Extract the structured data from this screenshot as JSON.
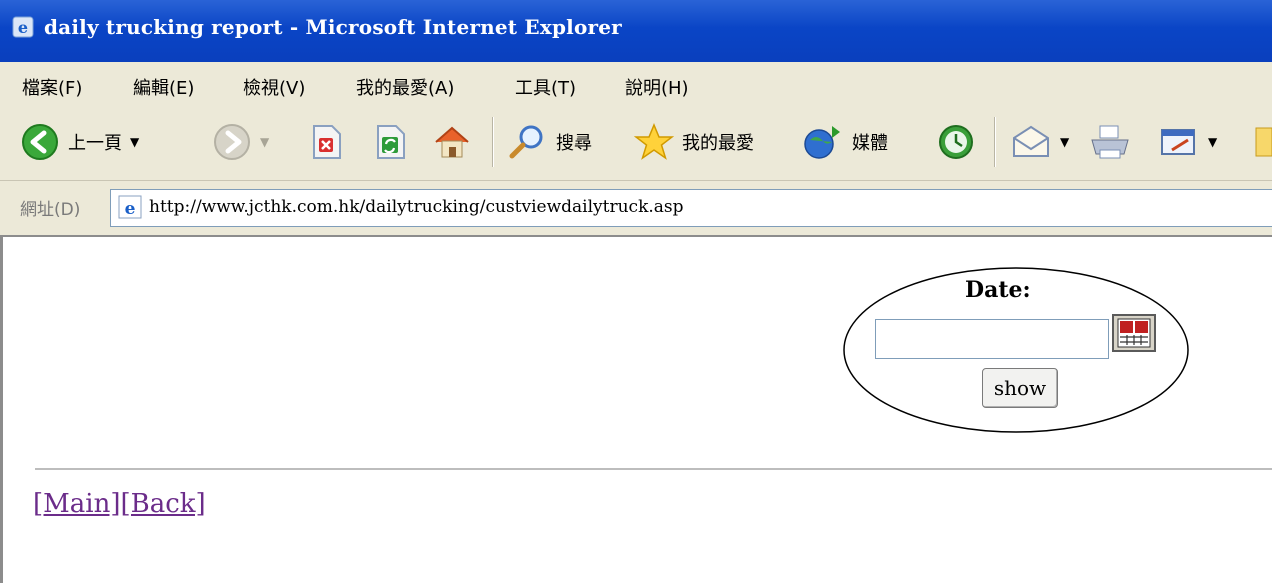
{
  "window": {
    "title": "daily trucking report - Microsoft Internet Explorer"
  },
  "menu": {
    "items": [
      "檔案(F)",
      "編輯(E)",
      "檢視(V)",
      "我的最愛(A)",
      "工具(T)",
      "說明(H)"
    ]
  },
  "toolbar": {
    "back_label": "上一頁",
    "search_label": "搜尋",
    "favorites_label": "我的最愛",
    "media_label": "媒體"
  },
  "address": {
    "label": "網址(D)",
    "url": "http://www.jcthk.com.hk/dailytrucking/custviewdailytruck.asp"
  },
  "form": {
    "date_label": "Date:",
    "date_value": "",
    "show_label": "show"
  },
  "links": {
    "main": "[Main]",
    "back": "[Back]"
  },
  "colors": {
    "titlebar": "#0a45c6",
    "chrome": "#ece9d8",
    "visited_link": "#6b2c8a"
  }
}
